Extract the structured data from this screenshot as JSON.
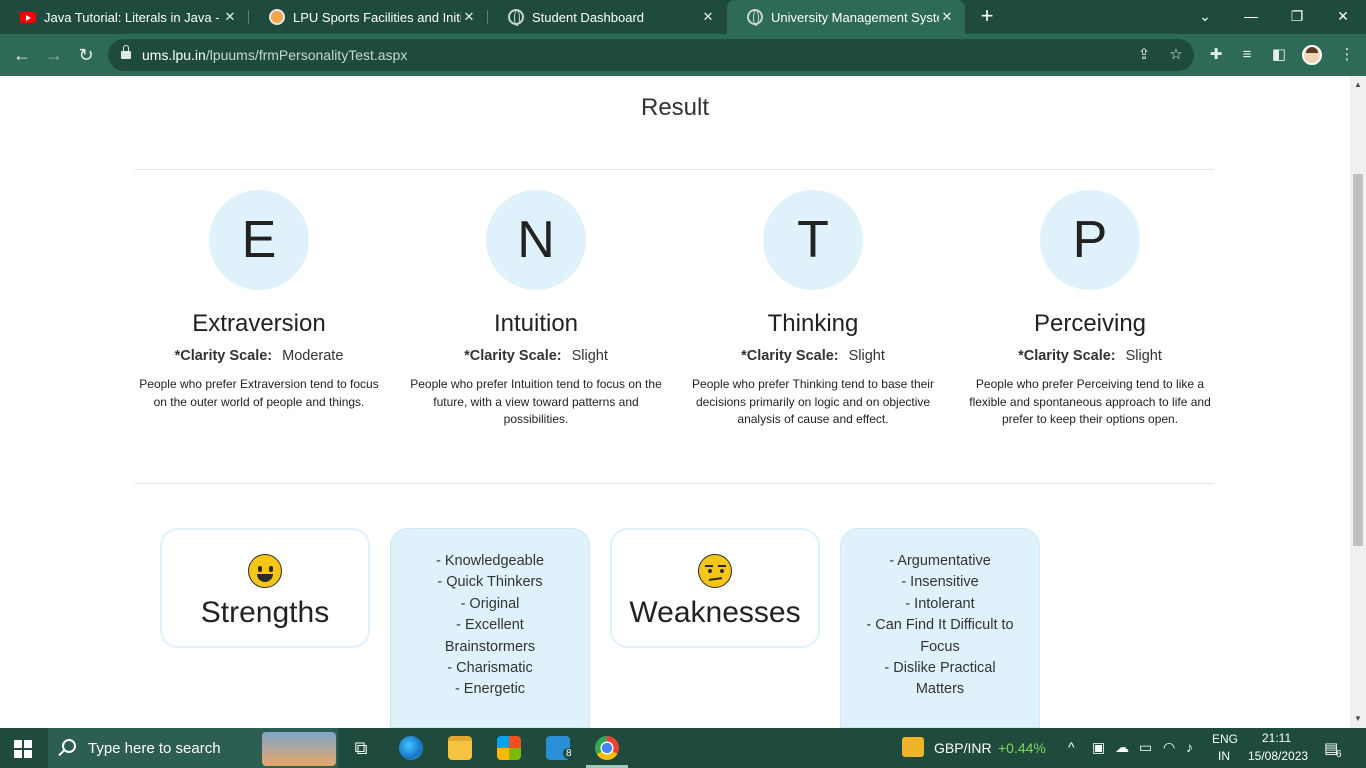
{
  "browser": {
    "tabs": [
      {
        "title": "Java Tutorial: Literals in Java - You",
        "favicon": "youtube-icon"
      },
      {
        "title": "LPU Sports Facilities and Initiatives",
        "favicon": "lpu-icon"
      },
      {
        "title": "Student Dashboard",
        "favicon": "globe-icon"
      },
      {
        "title": "University Management System -",
        "favicon": "globe-icon",
        "active": true
      }
    ],
    "url_host": "ums.lpu.in",
    "url_path": "/lpuums/frmPersonalityTest.aspx"
  },
  "page": {
    "title": "Result",
    "clarity_label": "*Clarity Scale:",
    "traits": [
      {
        "letter": "E",
        "name": "Extraversion",
        "clarity": "Moderate",
        "description": "People who prefer Extraversion tend to focus on the outer world of people and things."
      },
      {
        "letter": "N",
        "name": "Intuition",
        "clarity": "Slight",
        "description": "People who prefer Intuition tend to focus on the future, with a view toward patterns and possibilities."
      },
      {
        "letter": "T",
        "name": "Thinking",
        "clarity": "Slight",
        "description": "People who prefer Thinking tend to base their decisions primarily on logic and on objective analysis of cause and effect."
      },
      {
        "letter": "P",
        "name": "Perceiving",
        "clarity": "Slight",
        "description": "People who prefer Perceiving tend to like a flexible and spontaneous approach to life and prefer to keep their options open."
      }
    ],
    "strengths": {
      "label": "Strengths",
      "items": [
        "- Knowledgeable",
        "- Quick Thinkers",
        "- Original",
        "- Excellent Brainstormers",
        "- Charismatic",
        "- Energetic"
      ]
    },
    "weaknesses": {
      "label": "Weaknesses",
      "items": [
        "- Argumentative",
        "- Insensitive",
        "- Intolerant",
        "- Can Find It Difficult to Focus",
        "- Dislike Practical Matters"
      ]
    }
  },
  "taskbar": {
    "search_placeholder": "Type here to search",
    "mail_badge": "8",
    "ticker": "GBP/INR",
    "ticker_change": "+0.44%",
    "ticker_color": "#7ed957",
    "lang_top": "ENG",
    "lang_bottom": "IN",
    "time": "21:11",
    "date": "15/08/2023",
    "notification_count": "6"
  }
}
